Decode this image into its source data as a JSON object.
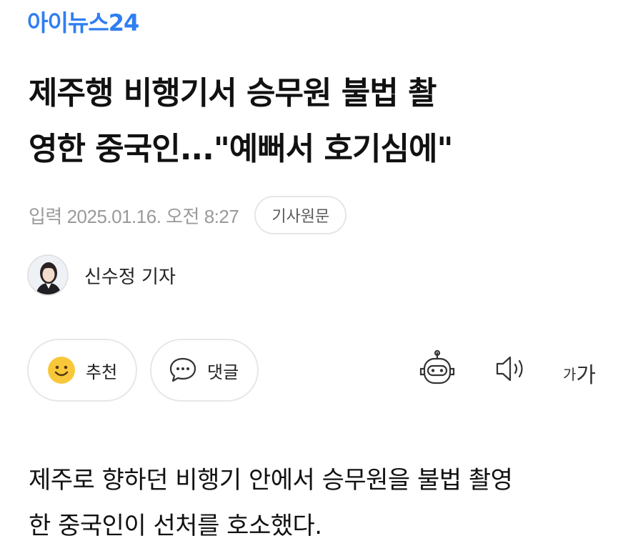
{
  "site": {
    "logo": "아이뉴스24"
  },
  "article": {
    "title_line1": "제주행 비행기서 승무원 불법 촬",
    "title_line2": "영한 중국인...\"예뻐서 호기심에\"",
    "date": "입력 2025.01.16. 오전 8:27",
    "origin_button": "기사원문",
    "author": "신수정 기자",
    "body_line1": "제주로 향하던 비행기 안에서 승무원을 불법 촬영",
    "body_line2": "한 중국인이 선처를 호소했다."
  },
  "actions": {
    "like_label": "추천",
    "comment_label": "댓글",
    "font_small": "가",
    "font_large": "가"
  },
  "icons": {
    "like": "smile-icon",
    "comment": "speech-bubble-icon",
    "summary": "robot-icon",
    "tts": "speaker-icon"
  },
  "colors": {
    "brand": "#2f7ef2",
    "date_gray": "#9a9a9a",
    "border": "#e7e7e7",
    "smile_yellow": "#f8c83a"
  }
}
